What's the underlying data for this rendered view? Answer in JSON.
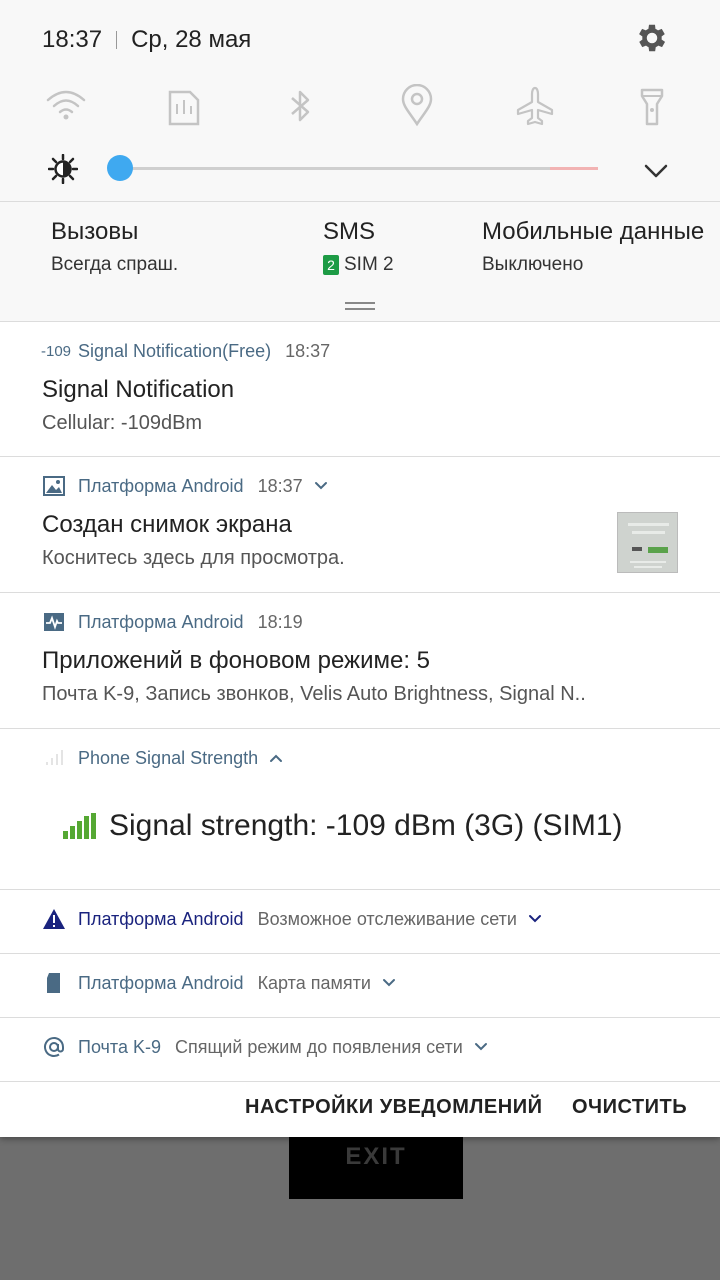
{
  "status_bar": {
    "time": "18:37",
    "date": "Ср, 28 мая"
  },
  "quick_settings": {
    "icons": [
      "wifi-icon",
      "nfc-icon",
      "bluetooth-icon",
      "location-icon",
      "airplane-icon",
      "flashlight-icon"
    ],
    "brightness_level": 0.02
  },
  "sim_settings": {
    "calls": {
      "title": "Вызовы",
      "value": "Всегда спраш."
    },
    "sms": {
      "title": "SMS",
      "sim_number": "2",
      "value": "SIM 2"
    },
    "mobile_data": {
      "title": "Мобильные данные",
      "value": "Выключено"
    }
  },
  "notifications": [
    {
      "icon_text": "-109",
      "app": "Signal Notification(Free)",
      "time": "18:37",
      "title": "Signal Notification",
      "text": "Cellular:   -109dBm"
    },
    {
      "app": "Платформа Android",
      "time": "18:37",
      "title": "Создан снимок экрана",
      "text": "Коснитесь здесь для просмотра."
    },
    {
      "app": "Платформа Android",
      "time": "18:19",
      "title": "Приложений в фоновом режиме: 5",
      "text": "Почта K-9, Запись звонков, Velis Auto Brightness, Signal N.."
    },
    {
      "app": "Phone Signal Strength",
      "text": "Signal strength: -109 dBm (3G) (SIM1)"
    },
    {
      "app": "Платформа Android",
      "text": "Возможное отслеживание сети"
    },
    {
      "app": "Платформа Android",
      "text": "Карта памяти"
    },
    {
      "app": "Почта K-9",
      "text": "Спящий режим до появления сети"
    }
  ],
  "footer": {
    "settings_label": "НАСТРОЙКИ УВЕДОМЛЕНИЙ",
    "clear_label": "ОЧИСТИТЬ"
  },
  "background_app": {
    "exit_label": "EXIT"
  },
  "colors": {
    "accent_blue": "#3fa9f0",
    "warning_navy": "#1a237e",
    "app_name": "#4a6a84",
    "sim_green": "#1d9b45"
  }
}
